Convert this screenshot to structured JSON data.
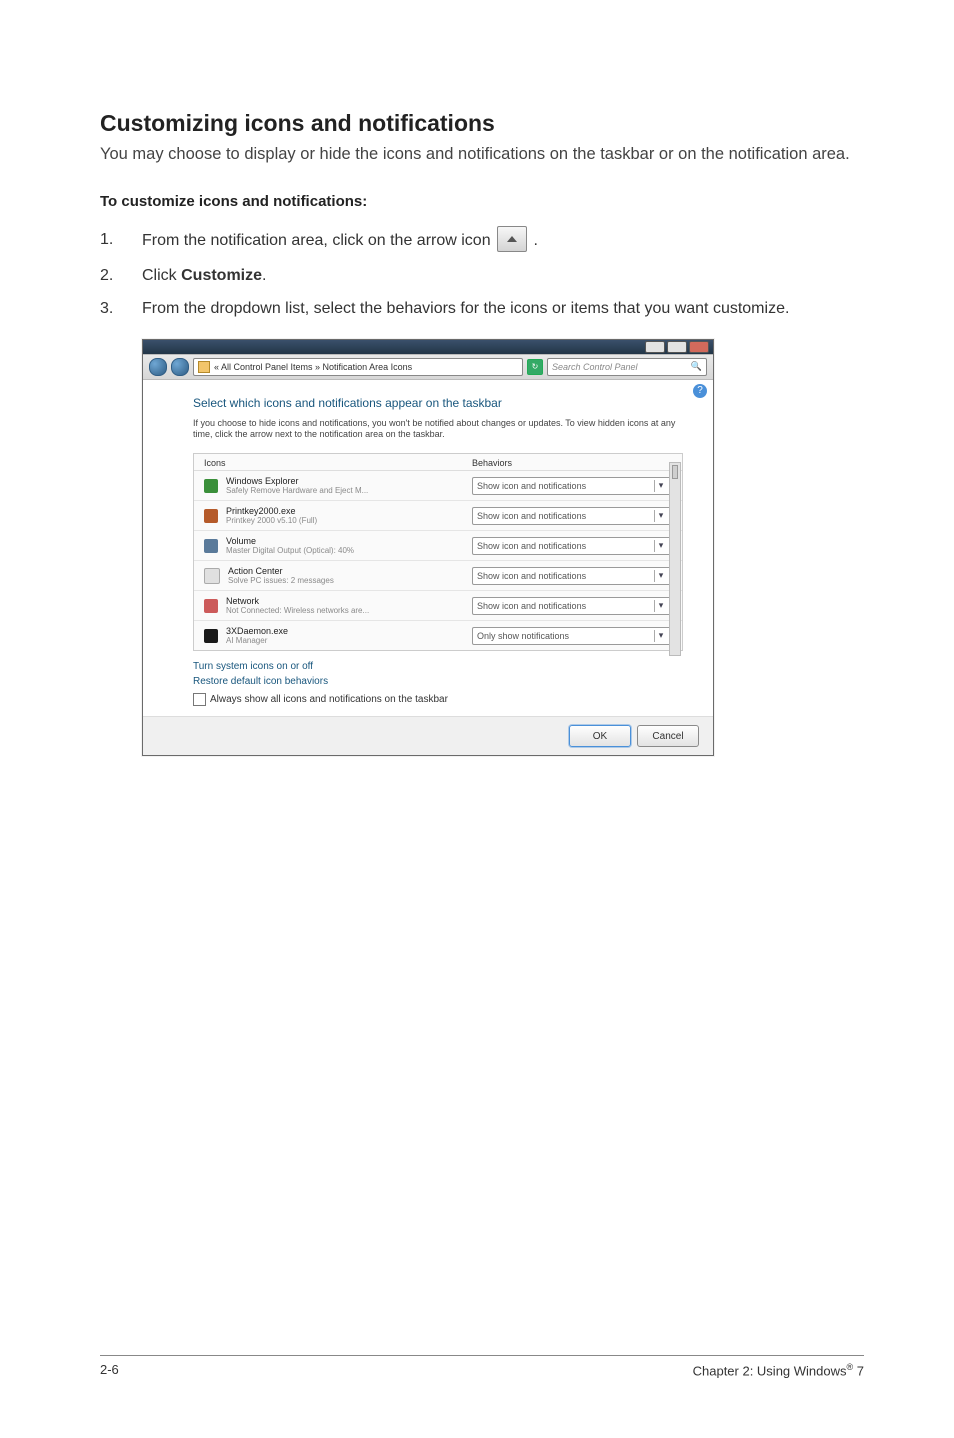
{
  "title": "Customizing icons and notifications",
  "intro": "You may choose to display or hide the icons and notifications on the taskbar or on the notification area.",
  "subhead": "To customize icons and notifications:",
  "steps": {
    "s1_a": "From the notification area, click on the arrow icon ",
    "s1_b": " .",
    "s2_a": "Click ",
    "s2_bold": "Customize",
    "s2_b": ".",
    "s3": "From the dropdown list, select the behaviors for the icons or items that you want customize."
  },
  "screenshot": {
    "breadcrumb": "« All Control Panel Items » Notification Area Icons",
    "search_placeholder": "Search Control Panel",
    "heading": "Select which icons and notifications appear on the taskbar",
    "desc": "If you choose to hide icons and notifications, you won't be notified about changes or updates. To view hidden icons at any time, click the arrow next to the notification area on the taskbar.",
    "headers": {
      "icons": "Icons",
      "behaviors": "Behaviors"
    },
    "rows": [
      {
        "name": "Windows Explorer",
        "sub": "Safely Remove Hardware and Eject M...",
        "behavior": "Show icon and notifications",
        "icon": "#3a8f3a"
      },
      {
        "name": "Printkey2000.exe",
        "sub": "Printkey 2000 v5.10 (Full)",
        "behavior": "Show icon and notifications",
        "icon": "#b55a2a"
      },
      {
        "name": "Volume",
        "sub": "Master Digital Output (Optical): 40%",
        "behavior": "Show icon and notifications",
        "icon": "#5a7a9a"
      },
      {
        "name": "Action Center",
        "sub": "Solve PC issues: 2 messages",
        "behavior": "Show icon and notifications",
        "icon": "#e0e0e0"
      },
      {
        "name": "Network",
        "sub": "Not Connected: Wireless networks are...",
        "behavior": "Show icon and notifications",
        "icon": "#cc5a5a"
      },
      {
        "name": "3XDaemon.exe",
        "sub": "AI Manager",
        "behavior": "Only show notifications",
        "icon": "#1a1a1a"
      }
    ],
    "link1": "Turn system icons on or off",
    "link2": "Restore default icon behaviors",
    "checkbox": "Always show all icons and notifications on the taskbar",
    "ok": "OK",
    "cancel": "Cancel"
  },
  "footer": {
    "left": "2-6",
    "right_a": "Chapter 2: Using Windows",
    "right_b": " 7"
  }
}
